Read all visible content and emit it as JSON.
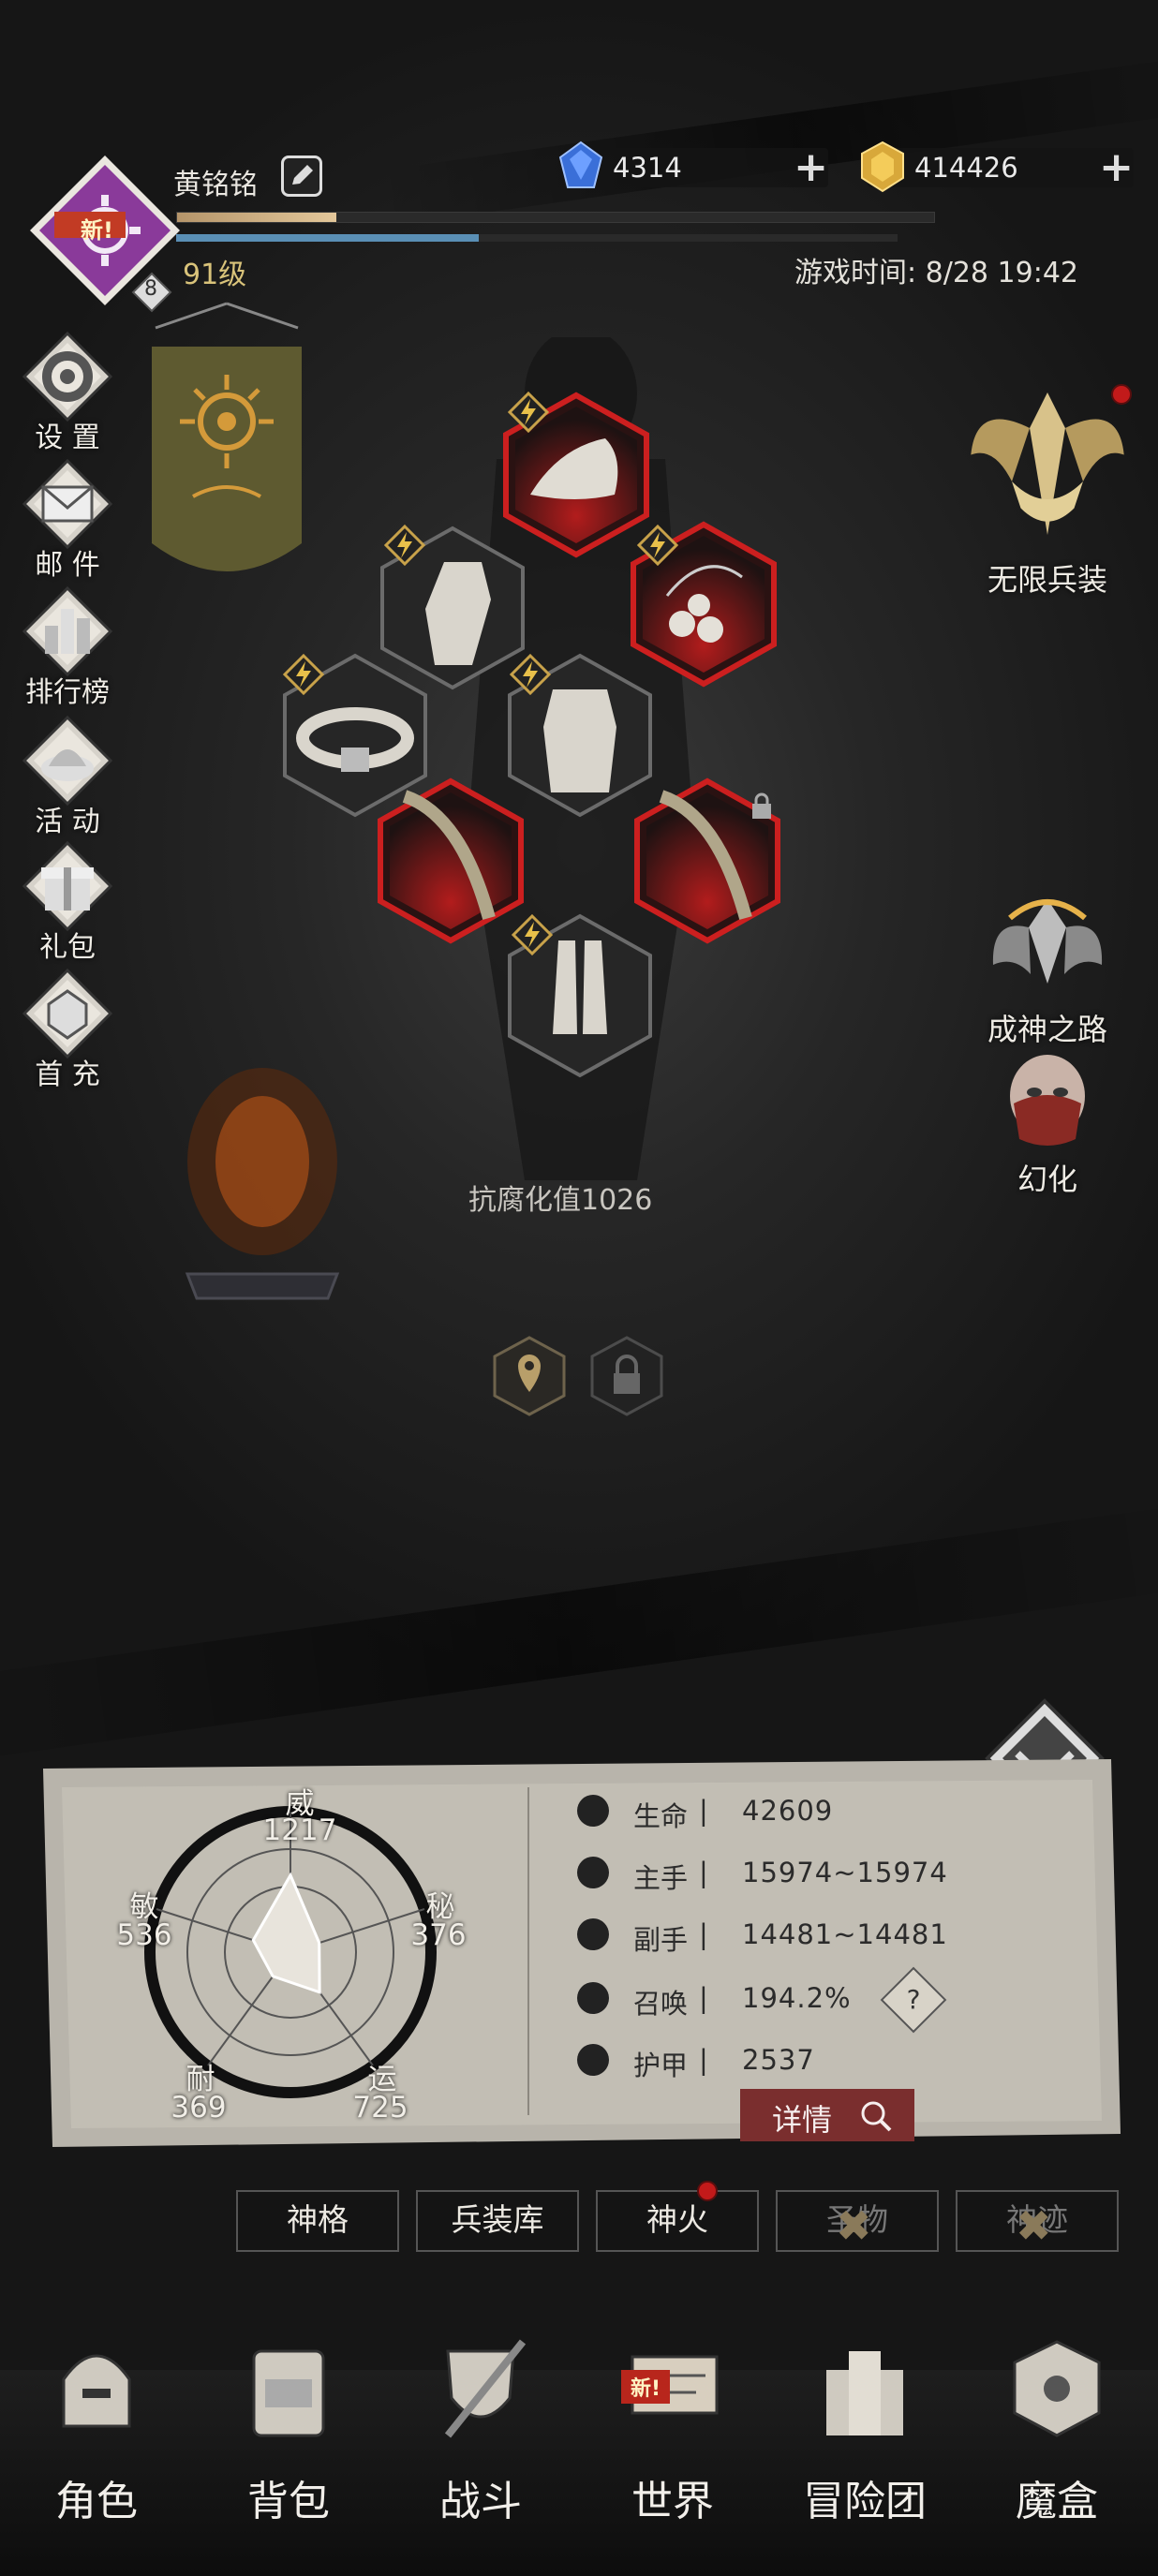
{
  "header": {
    "player_name": "黄铭铭",
    "level": "91级",
    "rank_badge": "8",
    "avatar_new": "新!",
    "blue_gem": "4314",
    "gold_gem": "414426",
    "game_time": "游戏时间: 8/28 19:42",
    "xp_progress": 0.21,
    "mp_progress": 0.42
  },
  "left_menu": [
    {
      "label": "设 置",
      "icon": "gear-icon"
    },
    {
      "label": "邮 件",
      "icon": "mail-icon"
    },
    {
      "label": "排行榜",
      "icon": "leaderboard-icon"
    },
    {
      "label": "活 动",
      "icon": "event-icon"
    },
    {
      "label": "礼包",
      "icon": "gift-icon"
    },
    {
      "label": "首 充",
      "icon": "first-recharge-icon"
    }
  ],
  "right_features": {
    "infinite_gear": "无限兵装",
    "god_path": "成神之路",
    "illusion": "幻化"
  },
  "equipment": {
    "corrosion": "抗腐化值1026",
    "slots": [
      "hat",
      "glove",
      "necklace",
      "belt",
      "armor",
      "main-weapon",
      "off-weapon",
      "boots"
    ]
  },
  "attributes": {
    "wei": {
      "name": "威",
      "value": "1217"
    },
    "mi": {
      "name": "秘",
      "value": "376"
    },
    "min": {
      "name": "敏",
      "value": "536"
    },
    "nai": {
      "name": "耐",
      "value": "369"
    },
    "yun": {
      "name": "运",
      "value": "725"
    }
  },
  "stats": [
    {
      "name": "生命",
      "value": "42609",
      "icon": "heart-icon"
    },
    {
      "name": "主手",
      "value": "15974~15974",
      "icon": "sword-icon"
    },
    {
      "name": "副手",
      "value": "14481~14481",
      "icon": "offhand-icon"
    },
    {
      "name": "召唤",
      "value": "194.2%",
      "icon": "summon-icon"
    },
    {
      "name": "护甲",
      "value": "2537",
      "icon": "armor-icon"
    }
  ],
  "stat_sep": "|",
  "help_label": "?",
  "detail_button": "详情",
  "tabs": [
    {
      "label": "神格",
      "locked": false
    },
    {
      "label": "兵装库",
      "locked": false
    },
    {
      "label": "神火",
      "locked": false
    },
    {
      "label": "圣物",
      "locked": true
    },
    {
      "label": "神迹",
      "locked": true
    }
  ],
  "nav": [
    {
      "label": "角色",
      "icon": "helmet-icon"
    },
    {
      "label": "背包",
      "icon": "backpack-icon"
    },
    {
      "label": "战斗",
      "icon": "shield-sword-icon"
    },
    {
      "label": "世界",
      "icon": "map-scroll-icon",
      "badge": "新!"
    },
    {
      "label": "冒险团",
      "icon": "castle-icon"
    },
    {
      "label": "魔盒",
      "icon": "cube-icon"
    }
  ],
  "colors": {
    "accent_red": "#c21a1a",
    "gold": "#d9c37a",
    "avatar_purple": "#8a3a9a"
  }
}
